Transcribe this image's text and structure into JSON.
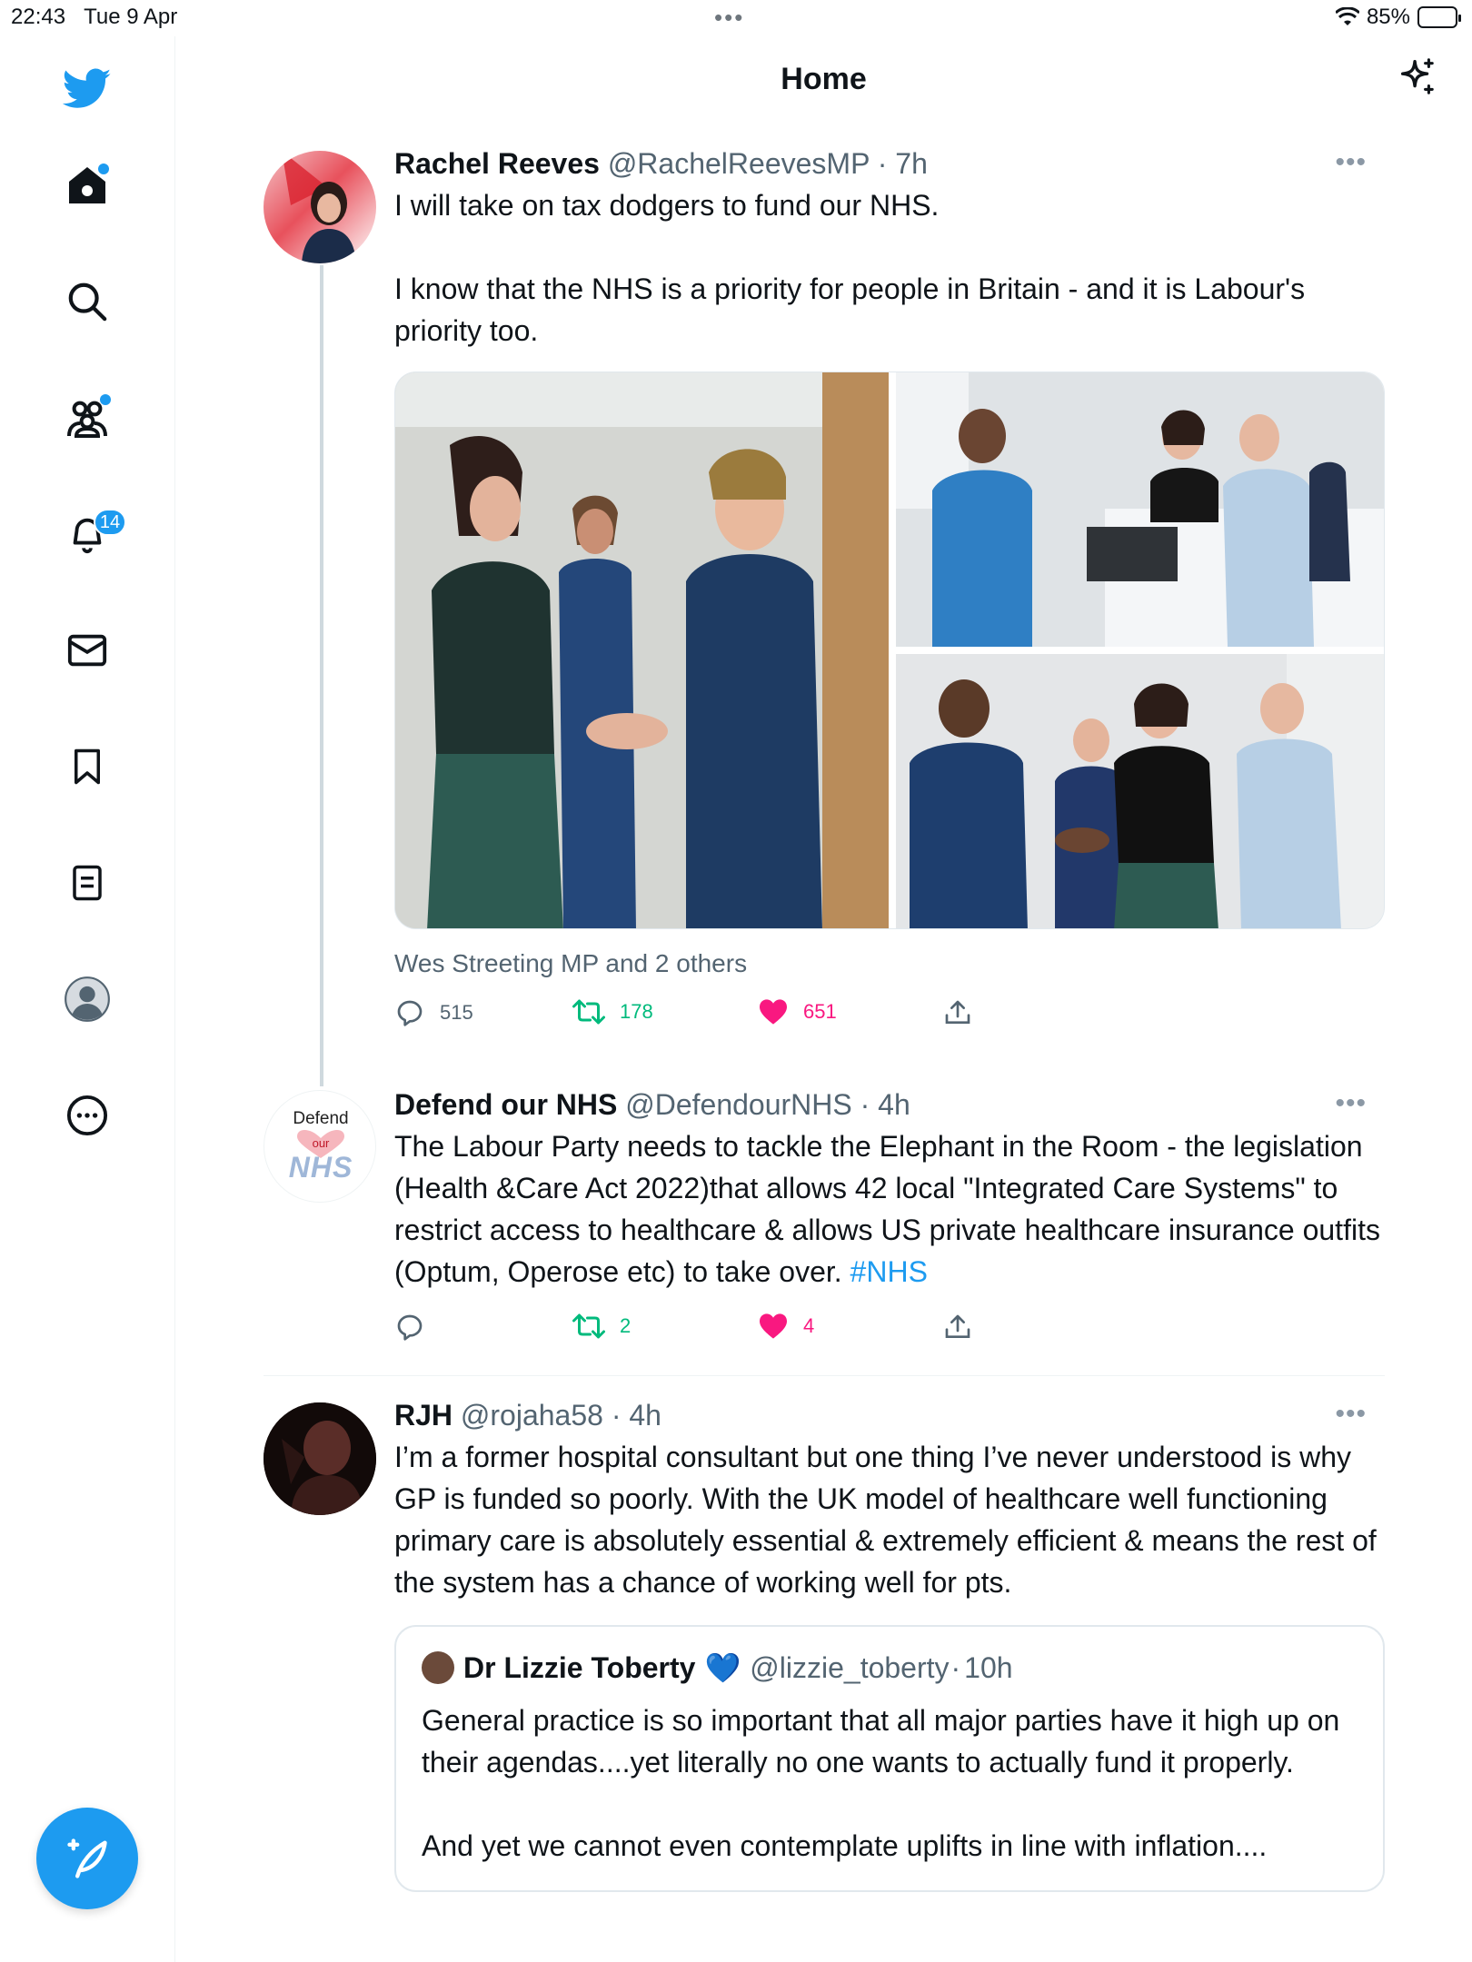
{
  "status_bar": {
    "time": "22:43",
    "date": "Tue 9 Apr",
    "battery": "85%",
    "battery_level": 0.85
  },
  "header": {
    "title": "Home"
  },
  "sidebar": {
    "items": [
      {
        "icon": "twitter-logo-icon"
      },
      {
        "icon": "home-icon",
        "has_dot": true
      },
      {
        "icon": "search-icon"
      },
      {
        "icon": "communities-icon",
        "has_dot": true
      },
      {
        "icon": "bell-icon",
        "badge": "14"
      },
      {
        "icon": "mail-icon"
      },
      {
        "icon": "bookmark-icon"
      },
      {
        "icon": "lists-icon"
      },
      {
        "icon": "profile-icon"
      },
      {
        "icon": "more-circle-icon"
      }
    ],
    "compose_icon": "compose-feather-icon"
  },
  "tweets": [
    {
      "name": "Rachel Reeves",
      "handle": "@RachelReevesMP",
      "time": "7h",
      "text": "I will take on tax dodgers to fund our NHS.\n\nI know that the NHS is a priority for people in Britain - and it is Labour's priority too.",
      "social_context": "Wes Streeting MP and 2 others",
      "replies": "515",
      "retweets": "178",
      "likes": "651"
    },
    {
      "name": "Defend our NHS",
      "handle": "@DefendourNHS",
      "time": "4h",
      "text": "The Labour Party needs to tackle the Elephant in the Room - the legislation (Health &Care Act 2022)that allows 42 local \"Integrated Care Systems\" to restrict access to healthcare & allows US private healthcare insurance outfits (Optum, Operose etc) to take over.",
      "hashtag": "#NHS",
      "avatar_text": {
        "line1": "Defend",
        "line2": "our",
        "line3": "NHS"
      },
      "replies": "",
      "retweets": "2",
      "likes": "4"
    },
    {
      "name": "RJH",
      "handle": "@rojaha58",
      "time": "4h",
      "text": "I’m a former hospital consultant but one thing I’ve never understood is why GP is funded so poorly. With the UK model of healthcare well functioning primary care is absolutely essential & extremely efficient & means the rest of the system has a chance of working well for pts.",
      "quote": {
        "name": "Dr Lizzie Toberty",
        "emoji": "💙",
        "handle": "@lizzie_toberty",
        "time": "10h",
        "text": "General practice is so important that all major parties have it high up on their agendas....yet literally no one wants to actually fund it properly.\n\nAnd yet we cannot even contemplate uplifts in line with inflation...."
      }
    }
  ],
  "colors": {
    "accent": "#1d9bf0",
    "retweet": "#00ba7c",
    "like": "#f91880",
    "secondary_text": "#536471"
  }
}
